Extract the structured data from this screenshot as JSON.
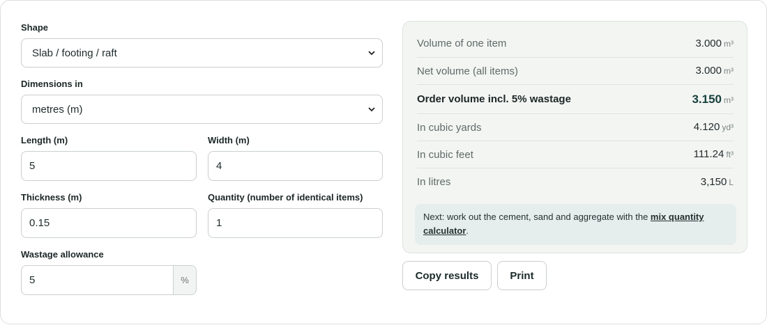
{
  "form": {
    "shape": {
      "label": "Shape",
      "selected": "Slab / footing / raft"
    },
    "units": {
      "label": "Dimensions in",
      "selected": "metres (m)"
    },
    "length": {
      "label": "Length (m)",
      "value": "5"
    },
    "width": {
      "label": "Width (m)",
      "value": "4"
    },
    "thickness": {
      "label": "Thickness (m)",
      "value": "0.15"
    },
    "quantity": {
      "label": "Quantity (number of identical items)",
      "value": "1"
    },
    "wastage": {
      "label": "Wastage allowance",
      "value": "5",
      "suffix": "%"
    }
  },
  "results": {
    "rows": [
      {
        "name": "Volume of one item",
        "value": "3.000",
        "unit": "m³"
      },
      {
        "name": "Net volume (all items)",
        "value": "3.000",
        "unit": "m³"
      },
      {
        "name": "Order volume incl. 5% wastage",
        "value": "3.150",
        "unit": "m³"
      },
      {
        "name": "In cubic yards",
        "value": "4.120",
        "unit": "yd³"
      },
      {
        "name": "In cubic feet",
        "value": "111.24",
        "unit": "ft³"
      },
      {
        "name": "In litres",
        "value": "3,150",
        "unit": "L"
      }
    ],
    "note": {
      "prefix": "Next: work out the cement, sand and aggregate with the ",
      "link": "mix quantity calculator",
      "suffix": "."
    }
  },
  "actions": {
    "copy_label": "Copy results",
    "print_label": "Print"
  },
  "icons": {
    "dropdown": "chevron-down-icon"
  },
  "colors": {
    "accent": "#16403c",
    "panel": "#f3f5f3",
    "note_bg": "#e5eeed"
  }
}
